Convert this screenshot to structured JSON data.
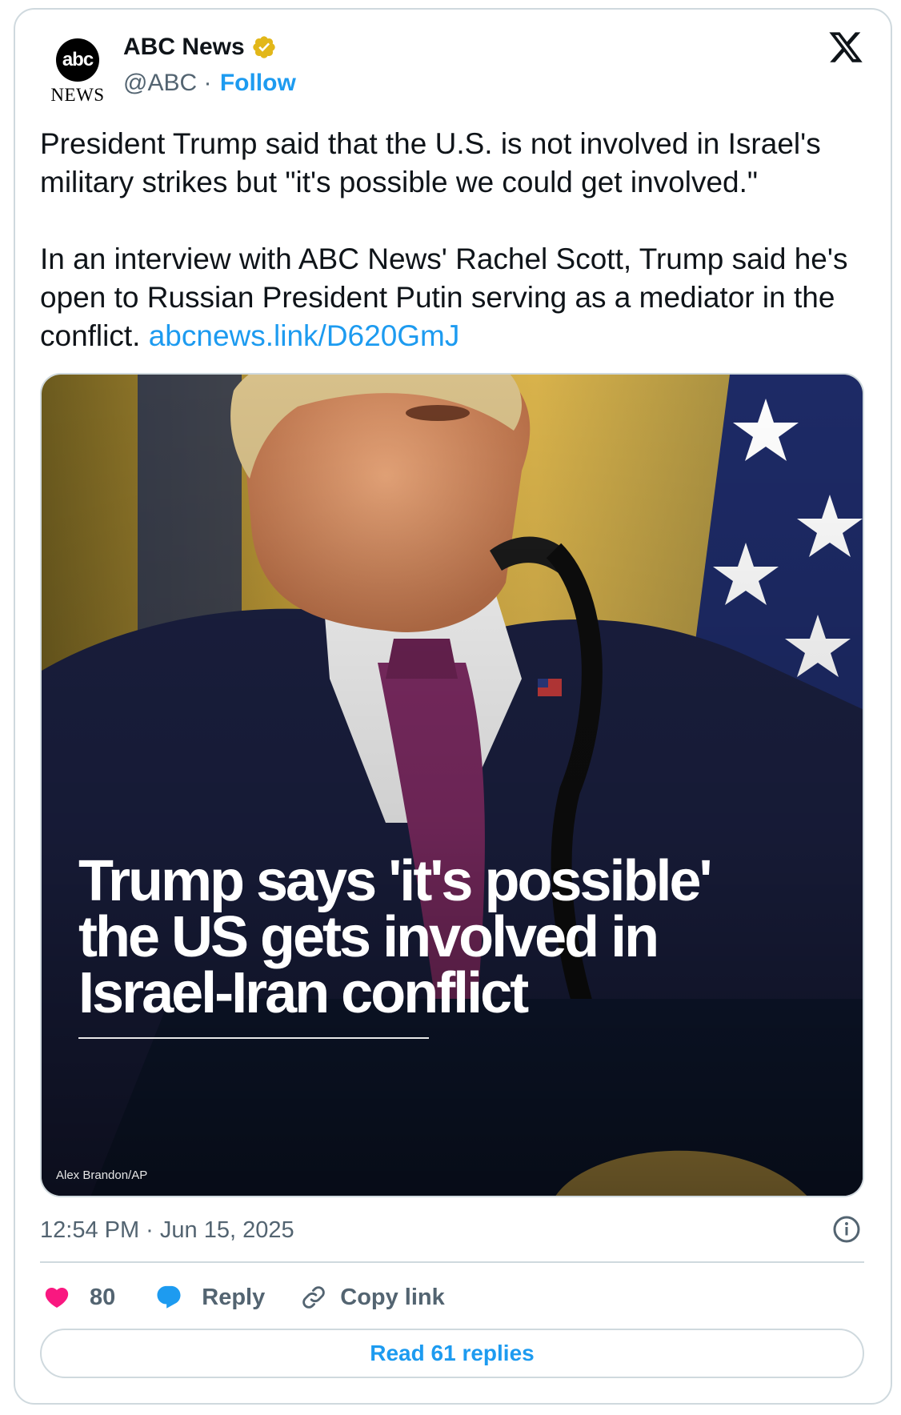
{
  "account": {
    "name": "ABC News",
    "handle": "@ABC",
    "separator": " · ",
    "follow_label": "Follow",
    "avatar_top": "abc",
    "avatar_bottom": "NEWS"
  },
  "tweet": {
    "paragraph1": "President Trump said that the U.S. is not involved in Israel's military strikes but \"it's possible we could get involved.\"",
    "paragraph2": "In an interview with ABC News' Rachel Scott, Trump said he's open to Russian President Putin serving as a mediator in the conflict. ",
    "link": "abcnews.link/D620GmJ"
  },
  "media": {
    "headline": "Trump says 'it's possible' the US gets involved in Israel-Iran conflict",
    "credit": "Alex Brandon/AP"
  },
  "meta": {
    "timestamp": "12:54 PM · Jun 15, 2025"
  },
  "actions": {
    "like_count": "80",
    "reply_label": "Reply",
    "copy_label": "Copy link"
  },
  "footer": {
    "read_replies": "Read 61 replies"
  },
  "colors": {
    "accent": "#1d9bf0",
    "like": "#f91880",
    "verified": "#e2b719"
  },
  "icons": [
    "verified-badge-icon",
    "x-logo-icon",
    "info-icon",
    "heart-icon",
    "reply-bubble-icon",
    "link-icon"
  ]
}
